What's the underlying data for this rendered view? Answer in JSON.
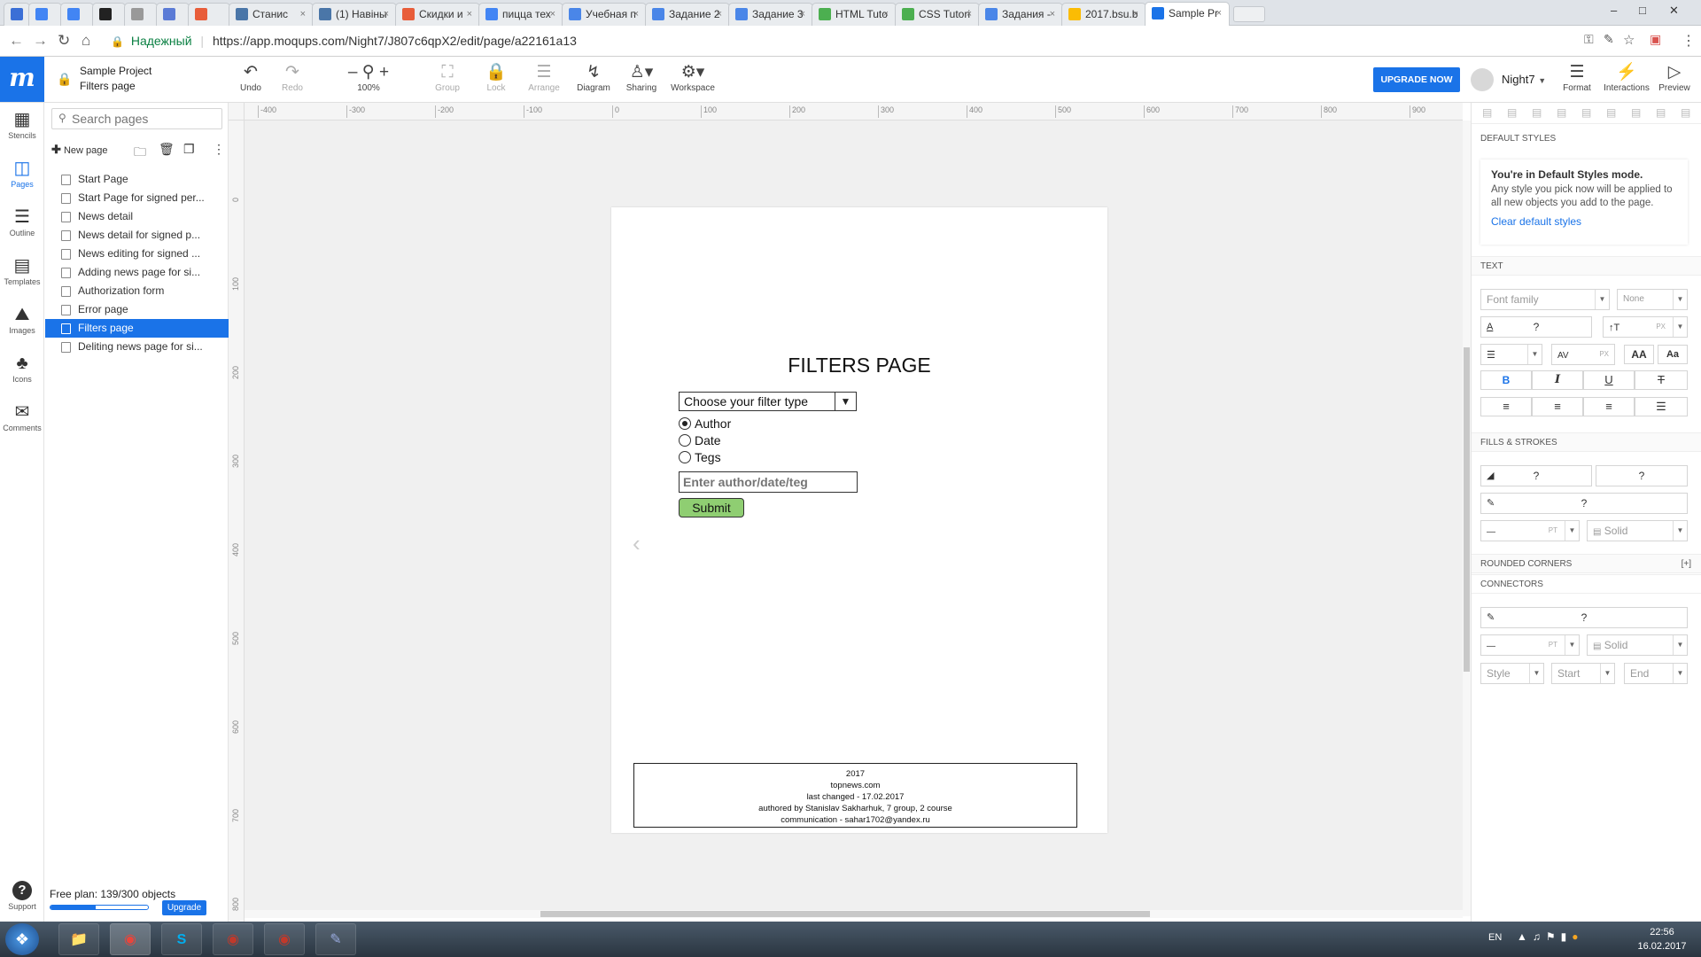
{
  "browser": {
    "tabs": [
      {
        "label": "",
        "color": "#3b6fd6"
      },
      {
        "label": "",
        "color": "#4285f4"
      },
      {
        "label": "",
        "color": "#4285f4"
      },
      {
        "label": "",
        "color": "#222222"
      },
      {
        "label": "",
        "color": "#999999"
      },
      {
        "label": "",
        "color": "#5b7bd6"
      },
      {
        "label": "",
        "color": "#e85d3a"
      },
      {
        "label": "Станис",
        "color": "#4a76a8"
      },
      {
        "label": "(1) Навіны",
        "color": "#4a76a8"
      },
      {
        "label": "Скидки и",
        "color": "#e85d3a"
      },
      {
        "label": "пицца тех",
        "color": "#4285f4"
      },
      {
        "label": "Учебная п",
        "color": "#4a86e8"
      },
      {
        "label": "Задание 2",
        "color": "#4a86e8"
      },
      {
        "label": "Задание 3",
        "color": "#4a86e8"
      },
      {
        "label": "HTML Tuto",
        "color": "#4caf50"
      },
      {
        "label": "CSS Tutori",
        "color": "#4caf50"
      },
      {
        "label": "Задания -",
        "color": "#4a86e8"
      },
      {
        "label": "2017.bsu.b",
        "color": "#fbbc04"
      },
      {
        "label": "Sample Pr",
        "color": "#1a73e8"
      }
    ],
    "secure_label": "Надежный",
    "url": "https://app.moqups.com/Night7/J807c6qpX2/edit/page/a22161a13"
  },
  "header": {
    "logo": "m",
    "project_name": "Sample Project",
    "page_name": "Filters page",
    "tools": {
      "undo": "Undo",
      "redo": "Redo",
      "zoom": "100%",
      "group": "Group",
      "lock": "Lock",
      "arrange": "Arrange",
      "diagram": "Diagram",
      "sharing": "Sharing",
      "workspace": "Workspace"
    },
    "upgrade_button": "UPGRADE NOW",
    "user_name": "Night7",
    "right_tools": {
      "format": "Format",
      "interactions": "Interactions",
      "preview": "Preview"
    }
  },
  "rail": {
    "stencils": "Stencils",
    "pages": "Pages",
    "outline": "Outline",
    "templates": "Templates",
    "images": "Images",
    "icons": "Icons",
    "comments": "Comments",
    "support": "Support"
  },
  "pages_panel": {
    "search_placeholder": "Search pages",
    "new_page": "New page",
    "pages": [
      "Start Page",
      "Start Page for signed per...",
      "News detail",
      "News detail for signed p...",
      "News editing for signed ...",
      "Adding news page for si...",
      "Authorization form",
      "Error page",
      "Filters page",
      "Deliting news page for si..."
    ],
    "selected_index": 8,
    "plan_text": "Free plan: 139/300 objects",
    "plan_usage": 0.46,
    "upgrade_label": "Upgrade"
  },
  "rulers": {
    "horizontal": [
      "-400",
      "-300",
      "-200",
      "-100",
      "0",
      "100",
      "200",
      "300",
      "400",
      "500",
      "600",
      "700",
      "800",
      "900"
    ],
    "vertical": [
      "0",
      "100",
      "200",
      "300",
      "400",
      "500",
      "600",
      "700",
      "800"
    ]
  },
  "mockup": {
    "title": "FILTERS PAGE",
    "select_value": "Choose your filter type",
    "radios": [
      "Author",
      "Date",
      "Tegs"
    ],
    "radio_selected": 0,
    "input_placeholder": "Enter author/date/teg",
    "submit_label": "Submit",
    "footer_lines": [
      "2017",
      "topnews.com",
      "last changed - 17.02.2017",
      "authored by Stanislav Sakharhuk, 7 group, 2 course",
      "communication - sahar1702@yandex.ru"
    ]
  },
  "right_panel": {
    "default_styles_heading": "DEFAULT STYLES",
    "default_mode_title": "You're in Default Styles mode.",
    "default_mode_text": "Any style you pick now will be applied to all new objects you add to the page.",
    "clear_link": "Clear default styles",
    "text_heading": "TEXT",
    "font_family": "Font family",
    "font_weight": "None",
    "q": "?",
    "px": "PX",
    "pt": "PT",
    "aa_upper": "AA",
    "aa_mixed": "Aa",
    "bold": "B",
    "italic": "I",
    "underline": "U",
    "strike": "T",
    "fills_heading": "FILLS & STROKES",
    "solid": "Solid",
    "rounded_heading": "ROUNDED CORNERS",
    "rounded_toggle": "[+]",
    "connectors_heading": "CONNECTORS",
    "style_label": "Style",
    "start_label": "Start",
    "end_label": "End"
  },
  "taskbar": {
    "lang": "EN",
    "time": "22:56",
    "date": "16.02.2017"
  },
  "colors": {
    "accent": "#1a73e8",
    "submit_green": "#8fce72",
    "secure_green": "#0b8043"
  }
}
